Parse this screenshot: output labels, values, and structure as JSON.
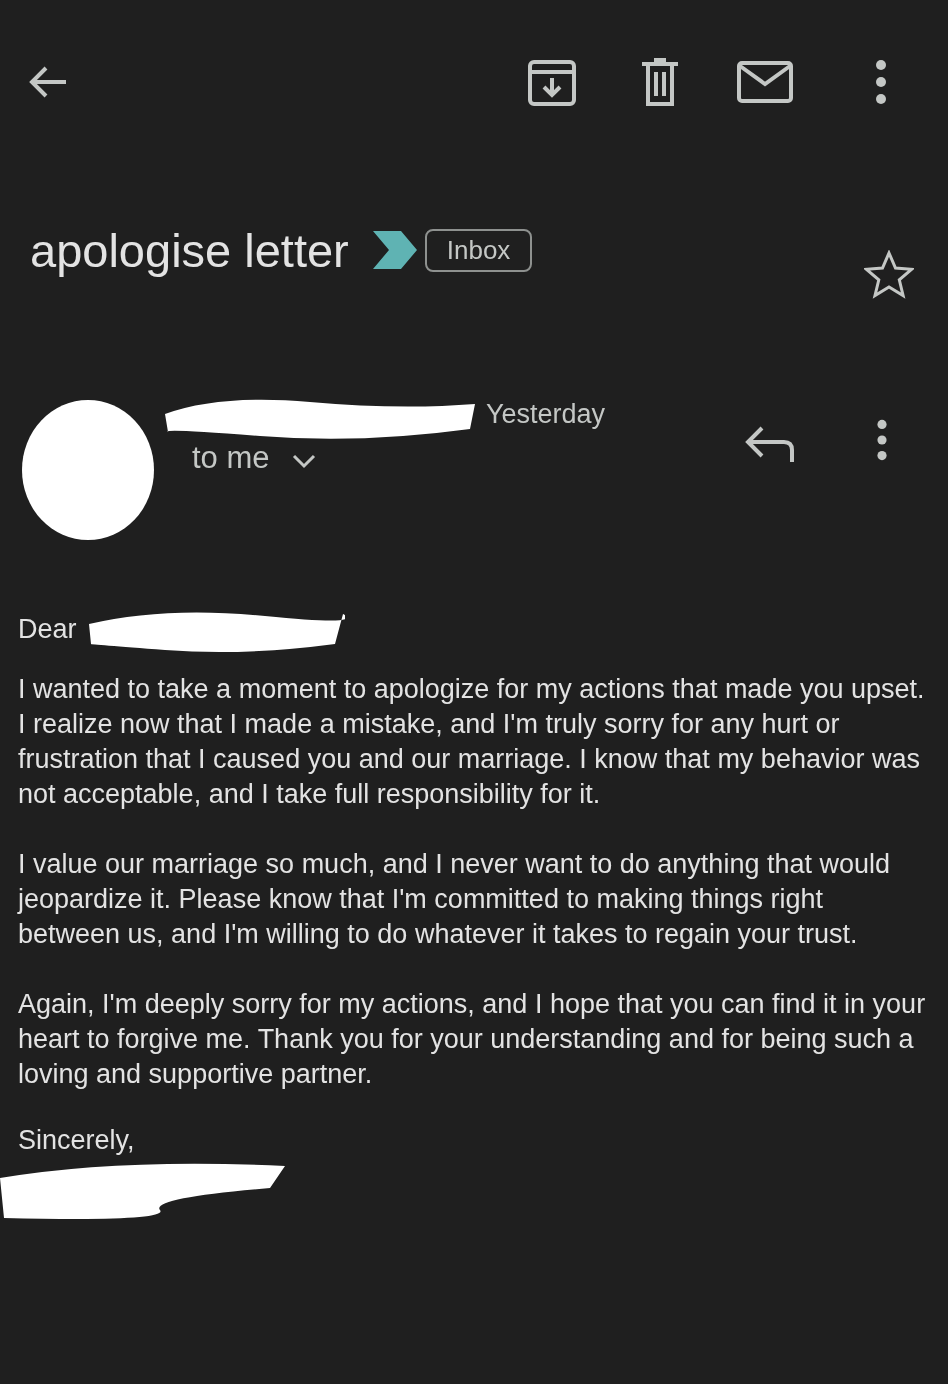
{
  "subject": {
    "title": "apologise letter",
    "label": "Inbox",
    "starred": false
  },
  "message": {
    "time": "Yesterday",
    "recipient": "to me"
  },
  "body": {
    "greeting": "Dear",
    "paragraphs": [
      "I wanted to take a moment to apologize for my actions that made you upset. I realize now that I made a mistake, and I'm truly sorry for any hurt or frustration that I caused you and our marriage. I know that my behavior was not acceptable, and I take full responsibility for it.",
      "I value our marriage so much, and I never want to do anything that would jeopardize it. Please know that I'm committed to making things right between us, and I'm willing to do whatever it takes to regain your trust.",
      "Again, I'm deeply sorry for my actions, and I hope that you can find it in your heart to forgive me. Thank you for your understanding and for being such a loving and supportive partner."
    ],
    "closing": "Sincerely,"
  }
}
